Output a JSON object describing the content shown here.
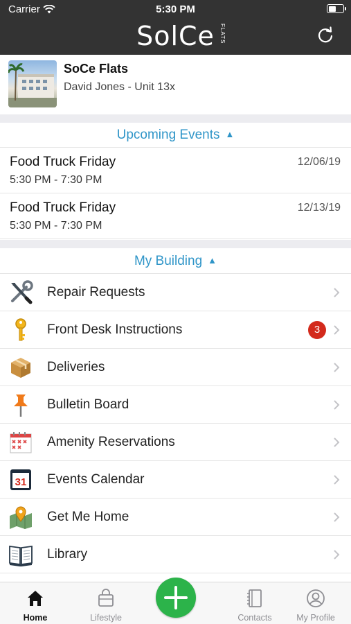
{
  "status_bar": {
    "carrier": "Carrier",
    "time": "5:30 PM"
  },
  "header": {
    "logo": "SolCe",
    "logo_sub": "FLATS",
    "refresh_icon": "refresh-icon"
  },
  "property": {
    "name": "SoCe Flats",
    "resident": "David Jones - Unit 13x"
  },
  "upcoming_events": {
    "title": "Upcoming Events",
    "events": [
      {
        "title": "Food Truck Friday",
        "time": "5:30 PM - 7:30 PM",
        "date": "12/06/19"
      },
      {
        "title": "Food Truck Friday",
        "time": "5:30 PM - 7:30 PM",
        "date": "12/13/19"
      }
    ]
  },
  "my_building": {
    "title": "My Building",
    "items": [
      {
        "label": "Repair Requests",
        "icon": "tools-icon"
      },
      {
        "label": "Front Desk Instructions",
        "icon": "key-icon",
        "badge": "3"
      },
      {
        "label": "Deliveries",
        "icon": "package-icon"
      },
      {
        "label": "Bulletin Board",
        "icon": "pushpin-icon"
      },
      {
        "label": "Amenity Reservations",
        "icon": "reservation-calendar-icon"
      },
      {
        "label": "Events Calendar",
        "icon": "calendar-31-icon"
      },
      {
        "label": "Get Me Home",
        "icon": "map-pin-icon"
      },
      {
        "label": "Library",
        "icon": "book-icon"
      }
    ]
  },
  "tabbar": {
    "tabs": [
      {
        "label": "Home",
        "icon": "home-icon",
        "active": true
      },
      {
        "label": "Lifestyle",
        "icon": "shopping-bag-icon"
      },
      {
        "label": "Contacts",
        "icon": "address-book-icon"
      },
      {
        "label": "My Profile",
        "icon": "profile-icon"
      }
    ],
    "center_button": "plus-icon"
  },
  "colors": {
    "header_bg": "#333333",
    "accent": "#2f95c8",
    "badge": "#d32a1c",
    "add_button": "#2cb34a"
  },
  "calendar_icon_text": "31"
}
